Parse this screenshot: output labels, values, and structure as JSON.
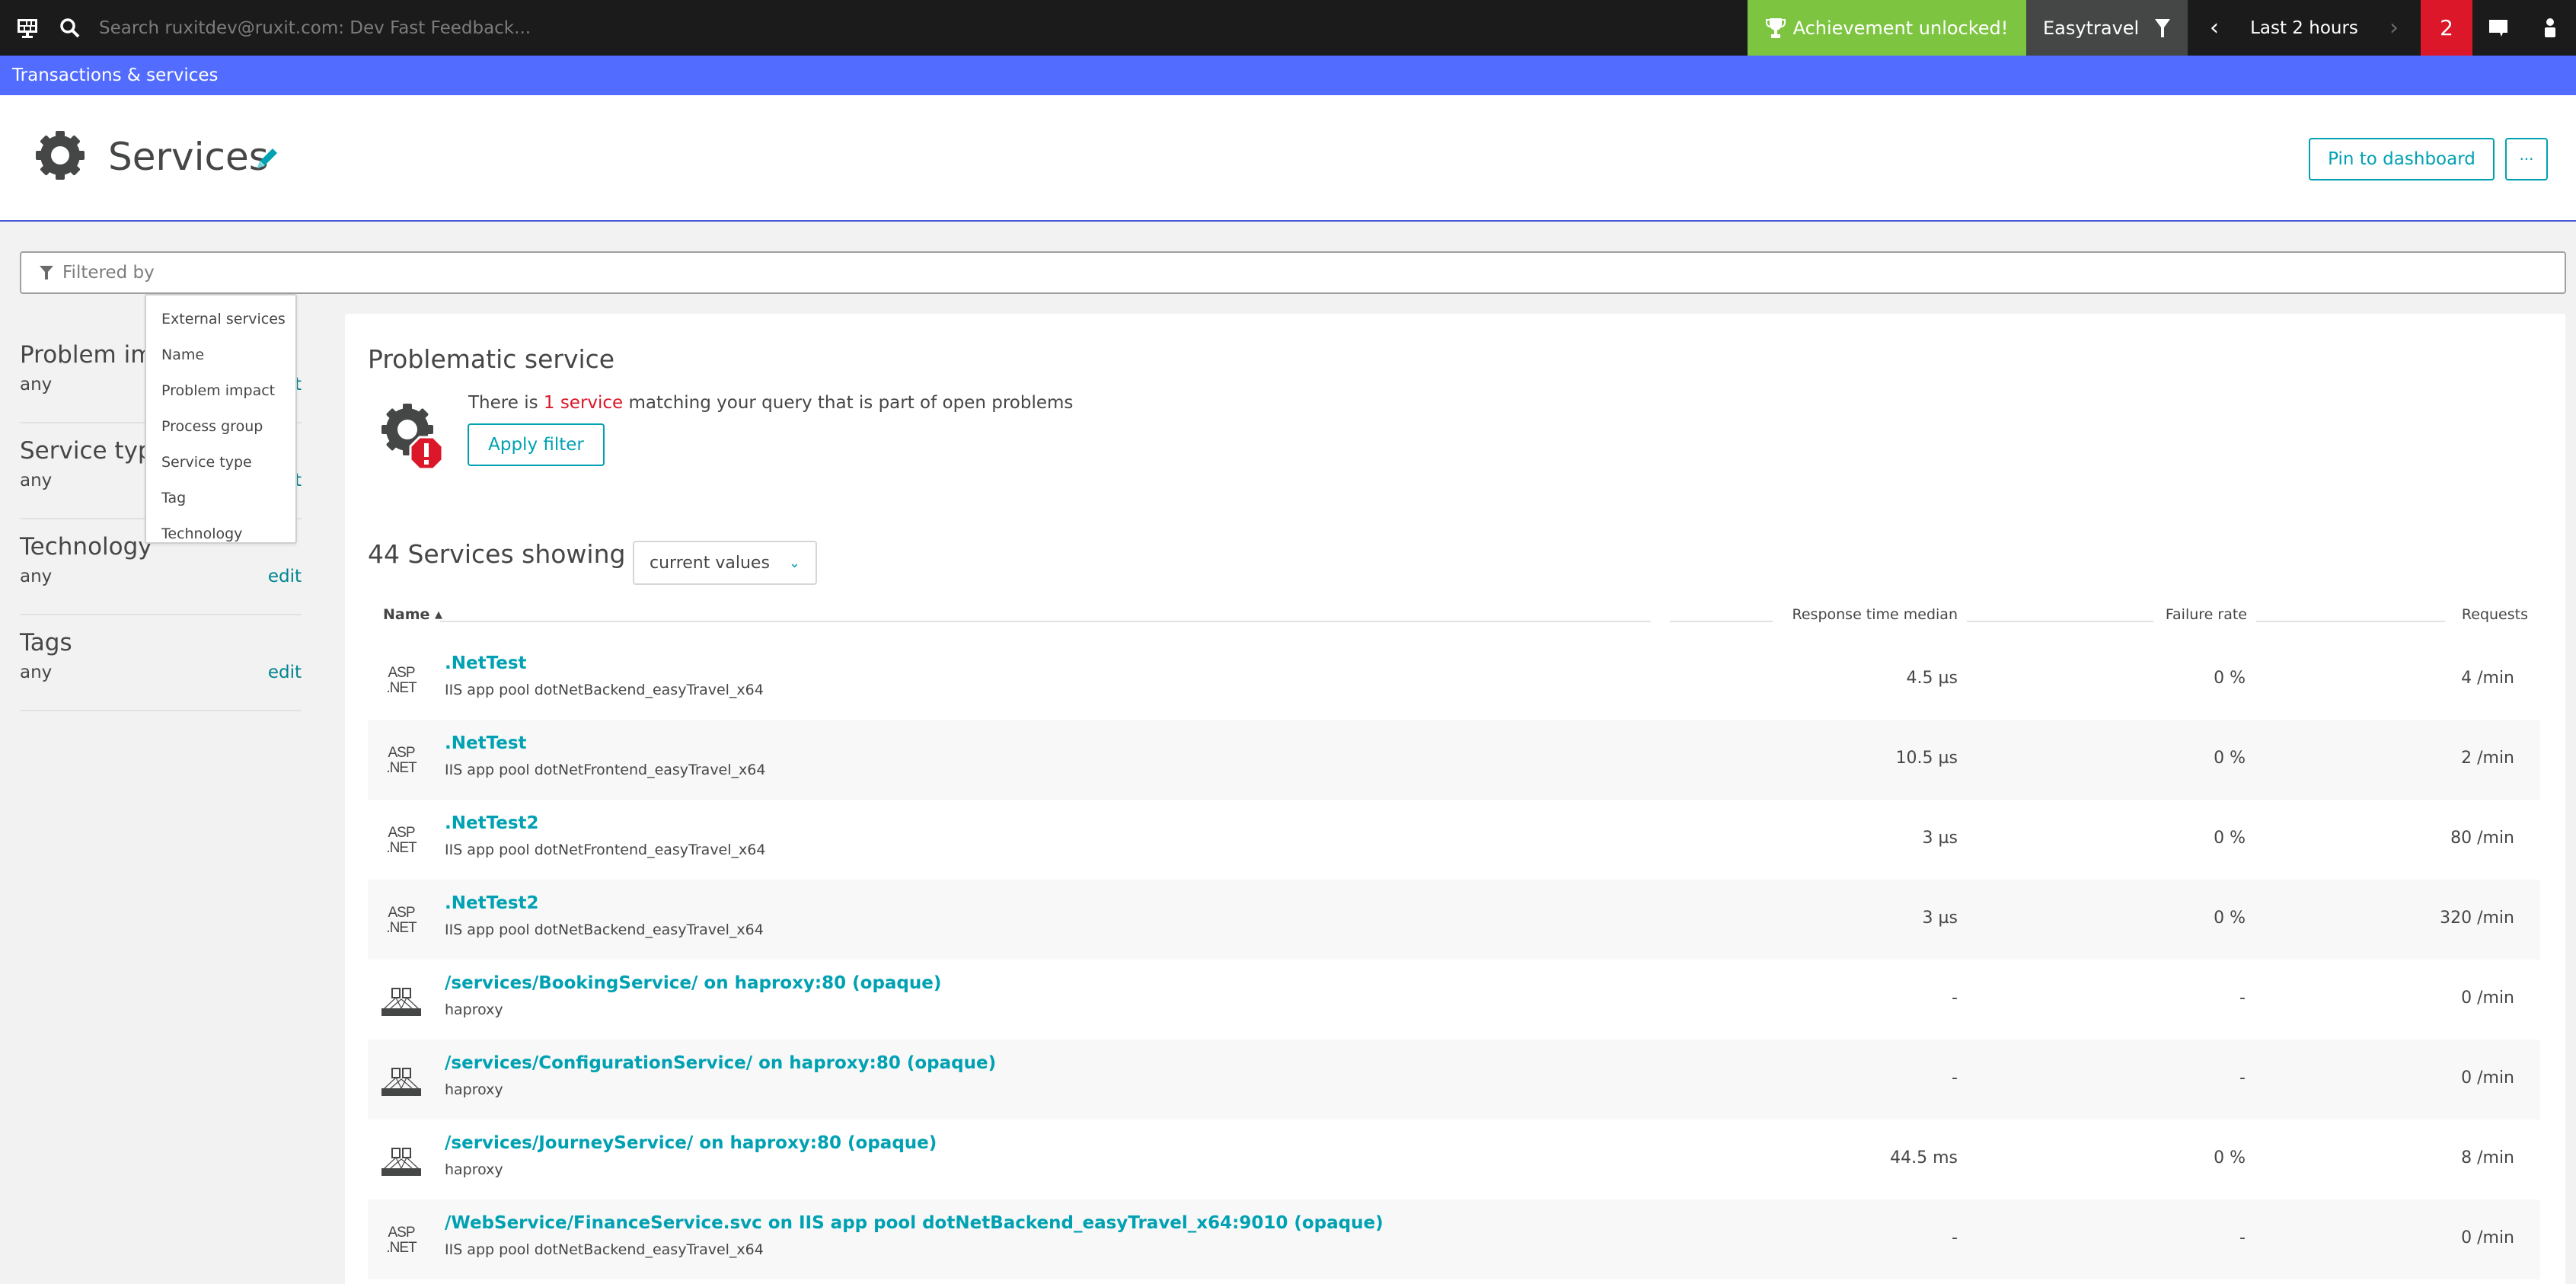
{
  "topbar": {
    "menu_icon": "dashboard-monitor-icon",
    "search_icon": "search-icon",
    "search_placeholder": "Search ruxitdev@ruxit.com: Dev Fast Feedback...",
    "achievement": "Achievement unlocked!",
    "environment": "Easytravel",
    "timeframe": "Last 2 hours",
    "problems_count": "2",
    "colors": {
      "achievement": "#7dc540",
      "problems": "#dc172a",
      "environment": "#454646"
    }
  },
  "breadcrumb": {
    "label": "Transactions & services",
    "color": "#526cff"
  },
  "header": {
    "title": "Services",
    "pin_label": "Pin to dashboard",
    "more_label": "···"
  },
  "filter": {
    "placeholder": "Filtered by",
    "dropdown": [
      "External services",
      "Name",
      "Problem impact",
      "Process group",
      "Service type",
      "Tag",
      "Technology"
    ]
  },
  "sidebar": {
    "sections": [
      {
        "title": "Problem impact",
        "value": "any",
        "edit": "edit"
      },
      {
        "title": "Service type",
        "value": "any",
        "edit": "edit"
      },
      {
        "title": "Technology",
        "value": "any",
        "edit": "edit"
      },
      {
        "title": "Tags",
        "value": "any",
        "edit": "edit"
      }
    ]
  },
  "problematic": {
    "title": "Problematic service",
    "text_before": "There is ",
    "highlight": "1 service",
    "text_after": " matching your query that is part of open problems",
    "apply_label": "Apply filter"
  },
  "services": {
    "count_title": "44 Services showing",
    "values_select": "current values",
    "columns": {
      "name": "Name",
      "sort_indicator": "▲",
      "response_time": "Response time median",
      "failure_rate": "Failure rate",
      "requests": "Requests"
    },
    "rows": [
      {
        "icon": "aspnet",
        "name": ".NetTest",
        "sub": "IIS app pool dotNetBackend_easyTravel_x64",
        "rt": "4.5 µs",
        "fr": "0 %",
        "rq": "4 /min"
      },
      {
        "icon": "aspnet",
        "name": ".NetTest",
        "sub": "IIS app pool dotNetFrontend_easyTravel_x64",
        "rt": "10.5 µs",
        "fr": "0 %",
        "rq": "2 /min"
      },
      {
        "icon": "aspnet",
        "name": ".NetTest2",
        "sub": "IIS app pool dotNetFrontend_easyTravel_x64",
        "rt": "3 µs",
        "fr": "0 %",
        "rq": "80 /min"
      },
      {
        "icon": "aspnet",
        "name": ".NetTest2",
        "sub": "IIS app pool dotNetBackend_easyTravel_x64",
        "rt": "3 µs",
        "fr": "0 %",
        "rq": "320 /min"
      },
      {
        "icon": "haproxy",
        "name": "/services/BookingService/ on haproxy:80 (opaque)",
        "sub": "haproxy",
        "rt": "-",
        "fr": "-",
        "rq": "0 /min"
      },
      {
        "icon": "haproxy",
        "name": "/services/ConfigurationService/ on haproxy:80 (opaque)",
        "sub": "haproxy",
        "rt": "-",
        "fr": "-",
        "rq": "0 /min"
      },
      {
        "icon": "haproxy",
        "name": "/services/JourneyService/ on haproxy:80 (opaque)",
        "sub": "haproxy",
        "rt": "44.5 ms",
        "fr": "0 %",
        "rq": "8 /min"
      },
      {
        "icon": "aspnet",
        "name": "/WebService/FinanceService.svc on IIS app pool dotNetBackend_easyTravel_x64:9010 (opaque)",
        "sub": "IIS app pool dotNetBackend_easyTravel_x64",
        "rt": "-",
        "fr": "-",
        "rq": "0 /min"
      }
    ]
  }
}
